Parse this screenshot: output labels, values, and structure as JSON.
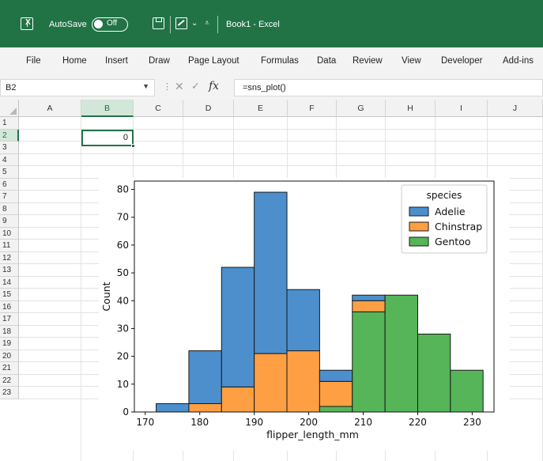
{
  "titlebar": {
    "autosave_label": "AutoSave",
    "toggle_label": "Off",
    "book_title": "Book1  -  Excel",
    "dropdown_glyph": "⌄",
    "customize_glyph": "⩡"
  },
  "ribbon": {
    "tabs": [
      "File",
      "Home",
      "Insert",
      "Draw",
      "Page Layout",
      "Formulas",
      "Data",
      "Review",
      "View",
      "Developer",
      "Add-ins"
    ]
  },
  "formula_bar": {
    "name_box": "B2",
    "formula": "=sns_plot()",
    "fx": "fx"
  },
  "grid": {
    "columns": [
      "A",
      "B",
      "C",
      "D",
      "E",
      "F",
      "G",
      "H",
      "I",
      "J"
    ],
    "rows": [
      "1",
      "2",
      "3",
      "4",
      "5",
      "6",
      "7",
      "8",
      "9",
      "10",
      "11",
      "12",
      "13",
      "14",
      "15",
      "16",
      "17",
      "18",
      "19",
      "20",
      "21",
      "22",
      "23"
    ],
    "active_cell_value": "0",
    "selected_column": "B",
    "selected_row": "2"
  },
  "colors": {
    "excel_green": "#217346",
    "adelie": "#4c8fcc",
    "chinstrap": "#ff9f44",
    "gentoo": "#55b558"
  },
  "chart_data": {
    "type": "bar",
    "subtype": "stacked histogram",
    "xlabel": "flipper_length_mm",
    "ylabel": "Count",
    "xlim": [
      168,
      234
    ],
    "ylim": [
      0,
      83
    ],
    "xticks": [
      170,
      180,
      190,
      200,
      210,
      220,
      230
    ],
    "yticks": [
      0,
      10,
      20,
      30,
      40,
      50,
      60,
      70,
      80
    ],
    "legend_title": "species",
    "legend_position": "top-right",
    "bin_edges": [
      172,
      178,
      184,
      190,
      196,
      202,
      208,
      214,
      220,
      226,
      232
    ],
    "series": [
      {
        "name": "Adelie",
        "color": "#4c8fcc",
        "values": [
          3,
          19,
          43,
          58,
          22,
          4,
          2,
          0,
          0,
          0
        ]
      },
      {
        "name": "Chinstrap",
        "color": "#ff9f44",
        "values": [
          0,
          3,
          9,
          21,
          22,
          9,
          4,
          0,
          0,
          0
        ]
      },
      {
        "name": "Gentoo",
        "color": "#55b558",
        "values": [
          0,
          0,
          0,
          0,
          0,
          2,
          36,
          42,
          28,
          15
        ]
      }
    ]
  }
}
